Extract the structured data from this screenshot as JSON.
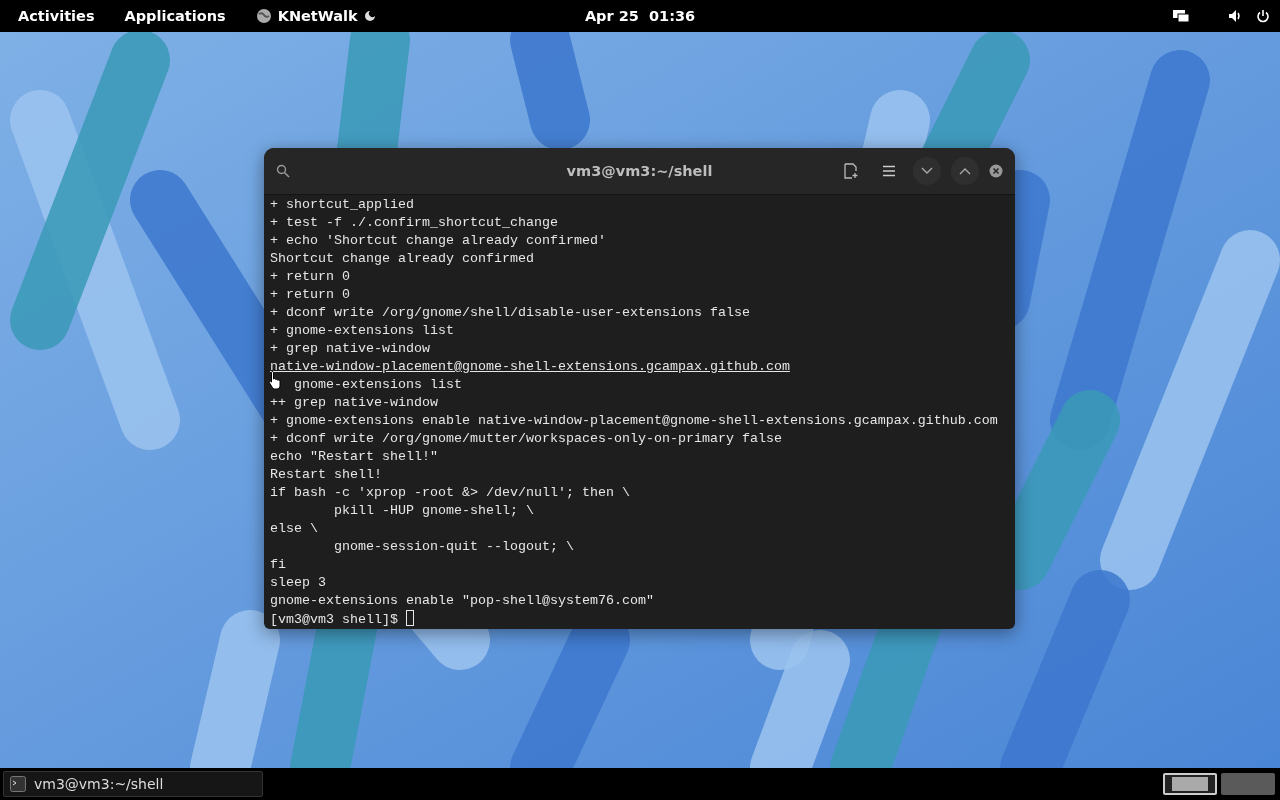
{
  "top_bar": {
    "activities": "Activities",
    "applications": "Applications",
    "app_menu": "KNetWalk",
    "clock": "Apr 25  01:36"
  },
  "terminal": {
    "title": "vm3@vm3:~/shell",
    "lines": [
      {
        "kind": "text",
        "text": "+ shortcut_applied"
      },
      {
        "kind": "text",
        "text": "+ test -f ./.confirm_shortcut_change"
      },
      {
        "kind": "text",
        "text": "+ echo 'Shortcut change already confirmed'"
      },
      {
        "kind": "text",
        "text": "Shortcut change already confirmed"
      },
      {
        "kind": "text",
        "text": "+ return 0"
      },
      {
        "kind": "text",
        "text": "+ return 0"
      },
      {
        "kind": "text",
        "text": "+ dconf write /org/gnome/shell/disable-user-extensions false"
      },
      {
        "kind": "text",
        "text": "+ gnome-extensions list"
      },
      {
        "kind": "text",
        "text": "+ grep native-window"
      },
      {
        "kind": "link",
        "text": "native-window-placement@gnome-shell-extensions.gcampax.github.com"
      },
      {
        "kind": "covered",
        "text": "gnome-extensions list"
      },
      {
        "kind": "text",
        "text": "++ grep native-window"
      },
      {
        "kind": "text",
        "text": "+ gnome-extensions enable native-window-placement@gnome-shell-extensions.gcampax.github.com"
      },
      {
        "kind": "text",
        "text": "+ dconf write /org/gnome/mutter/workspaces-only-on-primary false"
      },
      {
        "kind": "text",
        "text": "echo \"Restart shell!\""
      },
      {
        "kind": "text",
        "text": "Restart shell!"
      },
      {
        "kind": "text",
        "text": "if bash -c 'xprop -root &> /dev/null'; then \\"
      },
      {
        "kind": "text",
        "text": "        pkill -HUP gnome-shell; \\"
      },
      {
        "kind": "text",
        "text": "else \\"
      },
      {
        "kind": "text",
        "text": "        gnome-session-quit --logout; \\"
      },
      {
        "kind": "text",
        "text": "fi"
      },
      {
        "kind": "text",
        "text": "sleep 3"
      },
      {
        "kind": "text",
        "text": "gnome-extensions enable \"pop-shell@system76.com\""
      },
      {
        "kind": "prompt",
        "text": "[vm3@vm3 shell]$ "
      }
    ]
  },
  "taskbar": {
    "window_button": "vm3@vm3:~/shell",
    "workspaces": [
      {
        "selected": true
      },
      {
        "selected": false
      }
    ]
  }
}
